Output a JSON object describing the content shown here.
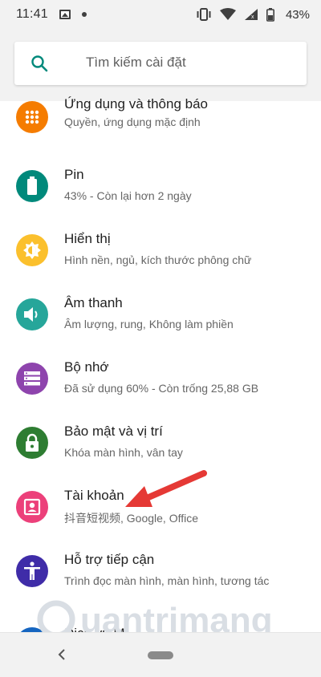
{
  "status_bar": {
    "time": "11:41",
    "battery": "43%"
  },
  "search": {
    "placeholder": "Tìm kiếm cài đặt"
  },
  "settings": [
    {
      "title": "Ứng dụng và thông báo",
      "subtitle": "Quyền, ứng dụng mặc định",
      "icon": "apps-grid-icon",
      "color": "#f57c00"
    },
    {
      "title": "Pin",
      "subtitle": "43% - Còn lại hơn 2 ngày",
      "icon": "battery-icon",
      "color": "#00897b"
    },
    {
      "title": "Hiển thị",
      "subtitle": "Hình nền, ngủ, kích thước phông chữ",
      "icon": "brightness-icon",
      "color": "#fbc02d"
    },
    {
      "title": "Âm thanh",
      "subtitle": "Âm lượng, rung, Không làm phiền",
      "icon": "volume-icon",
      "color": "#26a69a"
    },
    {
      "title": "Bộ nhớ",
      "subtitle": "Đã sử dụng 60% - Còn trống 25,88 GB",
      "icon": "storage-icon",
      "color": "#8e44ad"
    },
    {
      "title": "Bảo mật và vị trí",
      "subtitle": "Khóa màn hình, vân tay",
      "icon": "lock-icon",
      "color": "#2e7d32"
    },
    {
      "title": "Tài khoản",
      "subtitle": "抖音短视频, Google, Office",
      "icon": "account-box-icon",
      "color": "#ec407a"
    },
    {
      "title": "Hỗ trợ tiếp cận",
      "subtitle": "Trình đọc màn hình, màn hình, tương tác",
      "icon": "accessibility-icon",
      "color": "#3f2ca8"
    },
    {
      "title": "Dịch vụ Mi",
      "subtitle": "",
      "icon": "partial-icon",
      "color": "#1565c0"
    }
  ],
  "watermark": {
    "text": "uantrimang"
  },
  "colors": {
    "accent_search": "#00897b",
    "arrow": "#e53935"
  }
}
